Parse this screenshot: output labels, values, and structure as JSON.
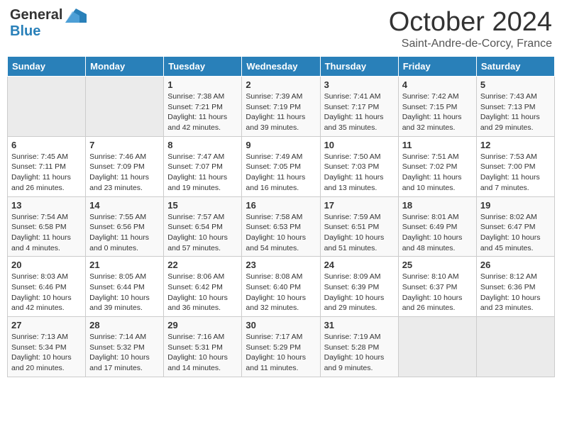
{
  "header": {
    "logo_general": "General",
    "logo_blue": "Blue",
    "month_title": "October 2024",
    "location": "Saint-Andre-de-Corcy, France"
  },
  "days_of_week": [
    "Sunday",
    "Monday",
    "Tuesday",
    "Wednesday",
    "Thursday",
    "Friday",
    "Saturday"
  ],
  "weeks": [
    {
      "days": [
        {
          "num": "",
          "sunrise": "",
          "sunset": "",
          "daylight": "",
          "empty": true
        },
        {
          "num": "",
          "sunrise": "",
          "sunset": "",
          "daylight": "",
          "empty": true
        },
        {
          "num": "1",
          "sunrise": "Sunrise: 7:38 AM",
          "sunset": "Sunset: 7:21 PM",
          "daylight": "Daylight: 11 hours and 42 minutes."
        },
        {
          "num": "2",
          "sunrise": "Sunrise: 7:39 AM",
          "sunset": "Sunset: 7:19 PM",
          "daylight": "Daylight: 11 hours and 39 minutes."
        },
        {
          "num": "3",
          "sunrise": "Sunrise: 7:41 AM",
          "sunset": "Sunset: 7:17 PM",
          "daylight": "Daylight: 11 hours and 35 minutes."
        },
        {
          "num": "4",
          "sunrise": "Sunrise: 7:42 AM",
          "sunset": "Sunset: 7:15 PM",
          "daylight": "Daylight: 11 hours and 32 minutes."
        },
        {
          "num": "5",
          "sunrise": "Sunrise: 7:43 AM",
          "sunset": "Sunset: 7:13 PM",
          "daylight": "Daylight: 11 hours and 29 minutes."
        }
      ]
    },
    {
      "days": [
        {
          "num": "6",
          "sunrise": "Sunrise: 7:45 AM",
          "sunset": "Sunset: 7:11 PM",
          "daylight": "Daylight: 11 hours and 26 minutes."
        },
        {
          "num": "7",
          "sunrise": "Sunrise: 7:46 AM",
          "sunset": "Sunset: 7:09 PM",
          "daylight": "Daylight: 11 hours and 23 minutes."
        },
        {
          "num": "8",
          "sunrise": "Sunrise: 7:47 AM",
          "sunset": "Sunset: 7:07 PM",
          "daylight": "Daylight: 11 hours and 19 minutes."
        },
        {
          "num": "9",
          "sunrise": "Sunrise: 7:49 AM",
          "sunset": "Sunset: 7:05 PM",
          "daylight": "Daylight: 11 hours and 16 minutes."
        },
        {
          "num": "10",
          "sunrise": "Sunrise: 7:50 AM",
          "sunset": "Sunset: 7:03 PM",
          "daylight": "Daylight: 11 hours and 13 minutes."
        },
        {
          "num": "11",
          "sunrise": "Sunrise: 7:51 AM",
          "sunset": "Sunset: 7:02 PM",
          "daylight": "Daylight: 11 hours and 10 minutes."
        },
        {
          "num": "12",
          "sunrise": "Sunrise: 7:53 AM",
          "sunset": "Sunset: 7:00 PM",
          "daylight": "Daylight: 11 hours and 7 minutes."
        }
      ]
    },
    {
      "days": [
        {
          "num": "13",
          "sunrise": "Sunrise: 7:54 AM",
          "sunset": "Sunset: 6:58 PM",
          "daylight": "Daylight: 11 hours and 4 minutes."
        },
        {
          "num": "14",
          "sunrise": "Sunrise: 7:55 AM",
          "sunset": "Sunset: 6:56 PM",
          "daylight": "Daylight: 11 hours and 0 minutes."
        },
        {
          "num": "15",
          "sunrise": "Sunrise: 7:57 AM",
          "sunset": "Sunset: 6:54 PM",
          "daylight": "Daylight: 10 hours and 57 minutes."
        },
        {
          "num": "16",
          "sunrise": "Sunrise: 7:58 AM",
          "sunset": "Sunset: 6:53 PM",
          "daylight": "Daylight: 10 hours and 54 minutes."
        },
        {
          "num": "17",
          "sunrise": "Sunrise: 7:59 AM",
          "sunset": "Sunset: 6:51 PM",
          "daylight": "Daylight: 10 hours and 51 minutes."
        },
        {
          "num": "18",
          "sunrise": "Sunrise: 8:01 AM",
          "sunset": "Sunset: 6:49 PM",
          "daylight": "Daylight: 10 hours and 48 minutes."
        },
        {
          "num": "19",
          "sunrise": "Sunrise: 8:02 AM",
          "sunset": "Sunset: 6:47 PM",
          "daylight": "Daylight: 10 hours and 45 minutes."
        }
      ]
    },
    {
      "days": [
        {
          "num": "20",
          "sunrise": "Sunrise: 8:03 AM",
          "sunset": "Sunset: 6:46 PM",
          "daylight": "Daylight: 10 hours and 42 minutes."
        },
        {
          "num": "21",
          "sunrise": "Sunrise: 8:05 AM",
          "sunset": "Sunset: 6:44 PM",
          "daylight": "Daylight: 10 hours and 39 minutes."
        },
        {
          "num": "22",
          "sunrise": "Sunrise: 8:06 AM",
          "sunset": "Sunset: 6:42 PM",
          "daylight": "Daylight: 10 hours and 36 minutes."
        },
        {
          "num": "23",
          "sunrise": "Sunrise: 8:08 AM",
          "sunset": "Sunset: 6:40 PM",
          "daylight": "Daylight: 10 hours and 32 minutes."
        },
        {
          "num": "24",
          "sunrise": "Sunrise: 8:09 AM",
          "sunset": "Sunset: 6:39 PM",
          "daylight": "Daylight: 10 hours and 29 minutes."
        },
        {
          "num": "25",
          "sunrise": "Sunrise: 8:10 AM",
          "sunset": "Sunset: 6:37 PM",
          "daylight": "Daylight: 10 hours and 26 minutes."
        },
        {
          "num": "26",
          "sunrise": "Sunrise: 8:12 AM",
          "sunset": "Sunset: 6:36 PM",
          "daylight": "Daylight: 10 hours and 23 minutes."
        }
      ]
    },
    {
      "days": [
        {
          "num": "27",
          "sunrise": "Sunrise: 7:13 AM",
          "sunset": "Sunset: 5:34 PM",
          "daylight": "Daylight: 10 hours and 20 minutes."
        },
        {
          "num": "28",
          "sunrise": "Sunrise: 7:14 AM",
          "sunset": "Sunset: 5:32 PM",
          "daylight": "Daylight: 10 hours and 17 minutes."
        },
        {
          "num": "29",
          "sunrise": "Sunrise: 7:16 AM",
          "sunset": "Sunset: 5:31 PM",
          "daylight": "Daylight: 10 hours and 14 minutes."
        },
        {
          "num": "30",
          "sunrise": "Sunrise: 7:17 AM",
          "sunset": "Sunset: 5:29 PM",
          "daylight": "Daylight: 10 hours and 11 minutes."
        },
        {
          "num": "31",
          "sunrise": "Sunrise: 7:19 AM",
          "sunset": "Sunset: 5:28 PM",
          "daylight": "Daylight: 10 hours and 9 minutes."
        },
        {
          "num": "",
          "sunrise": "",
          "sunset": "",
          "daylight": "",
          "empty": true
        },
        {
          "num": "",
          "sunrise": "",
          "sunset": "",
          "daylight": "",
          "empty": true
        }
      ]
    }
  ]
}
